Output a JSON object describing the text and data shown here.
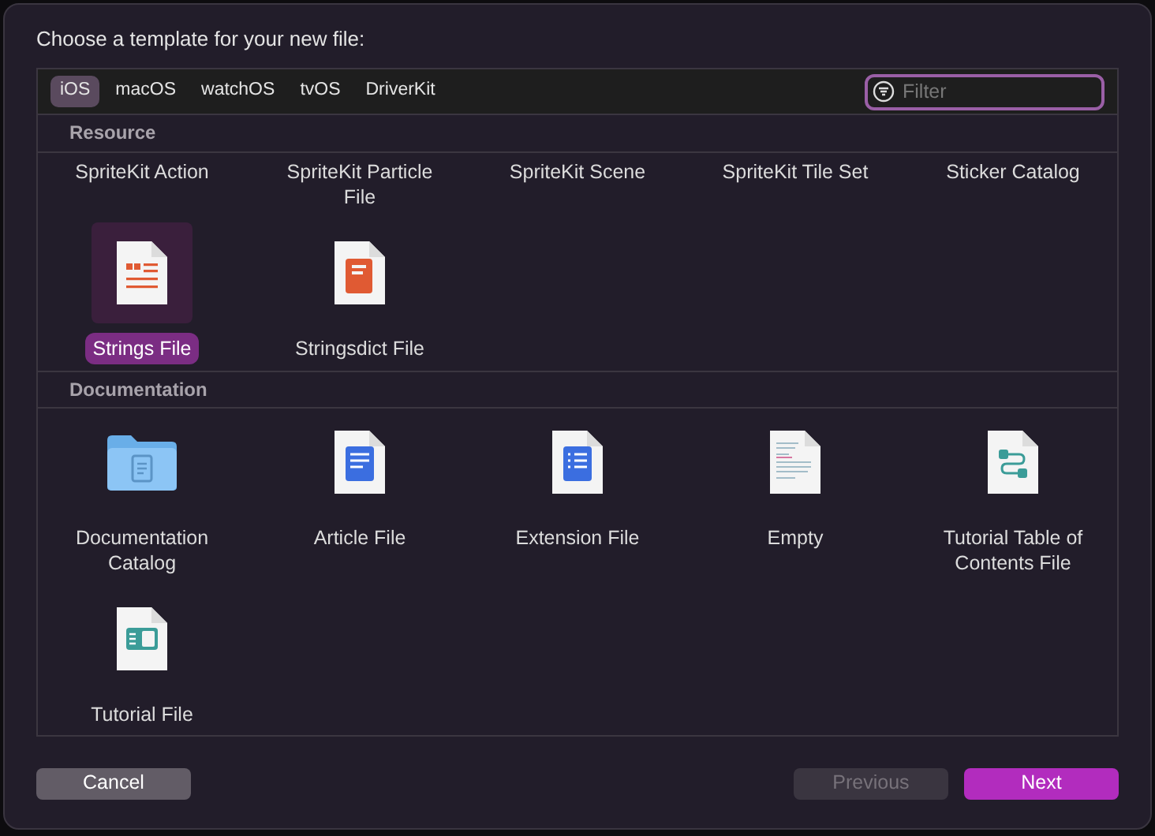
{
  "title": "Choose a template for your new file:",
  "tabs": [
    {
      "label": "iOS",
      "selected": true
    },
    {
      "label": "macOS",
      "selected": false
    },
    {
      "label": "watchOS",
      "selected": false
    },
    {
      "label": "tvOS",
      "selected": false
    },
    {
      "label": "DriverKit",
      "selected": false
    }
  ],
  "filter": {
    "placeholder": "Filter"
  },
  "sections": [
    {
      "title": "Resource",
      "items": [
        {
          "label": "SpriteKit Action",
          "selected": false
        },
        {
          "label": "SpriteKit Particle File",
          "selected": false
        },
        {
          "label": "SpriteKit Scene",
          "selected": false
        },
        {
          "label": "SpriteKit Tile Set",
          "selected": false
        },
        {
          "label": "Sticker Catalog",
          "selected": false
        },
        {
          "label": "Strings File",
          "selected": true,
          "kind": "quotes"
        },
        {
          "label": "Stringsdict File",
          "selected": false,
          "kind": "book"
        }
      ]
    },
    {
      "title": "Documentation",
      "items": [
        {
          "label": "Documentation Catalog",
          "selected": false,
          "kind": "folder"
        },
        {
          "label": "Article File",
          "selected": false,
          "kind": "article"
        },
        {
          "label": "Extension File",
          "selected": false,
          "kind": "list"
        },
        {
          "label": "Empty",
          "selected": false,
          "kind": "text"
        },
        {
          "label": "Tutorial Table of Contents File",
          "selected": false,
          "kind": "flow"
        },
        {
          "label": "Tutorial File",
          "selected": false,
          "kind": "tutorial"
        }
      ]
    }
  ],
  "buttons": [
    {
      "label": "Cancel",
      "kind": "cancel",
      "disabled": false
    },
    {
      "label": "Previous",
      "kind": "secondary",
      "disabled": true
    },
    {
      "label": "Next",
      "kind": "primary",
      "disabled": false
    }
  ]
}
